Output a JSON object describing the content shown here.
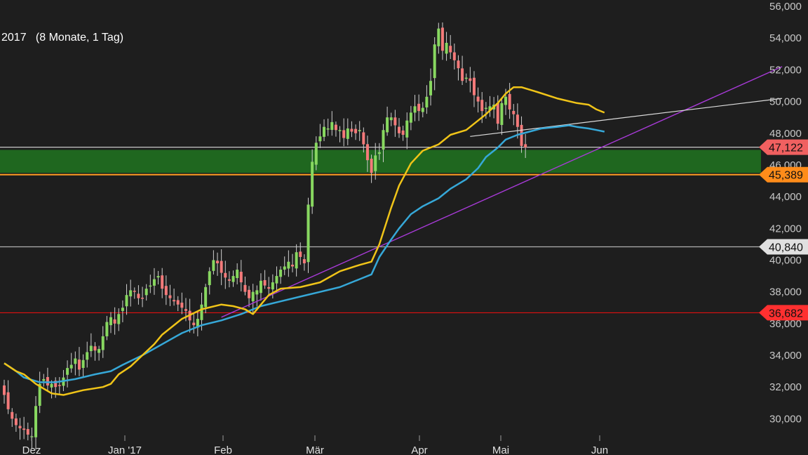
{
  "header": {
    "period_label": "2017   (8 Monate, 1 Tag)"
  },
  "chart_data": {
    "type": "candlestick",
    "title": "2017   (8 Monate, 1 Tag)",
    "ylim": [
      28.6,
      56.4
    ],
    "grid": false,
    "x_tick_labels": [
      "Dez",
      "Jan '17",
      "Feb",
      "Mär",
      "Apr",
      "Mai",
      "Jun"
    ],
    "y_tick_labels": [
      "30,000",
      "32,000",
      "34,000",
      "36,000",
      "38,000",
      "40,000",
      "42,000",
      "44,000",
      "46,000",
      "48,000",
      "50,000",
      "52,000",
      "54,000",
      "56,000"
    ],
    "y_ticks": [
      30,
      32,
      34,
      36,
      38,
      40,
      42,
      44,
      46,
      48,
      50,
      52,
      54,
      56
    ],
    "candle_closes": [
      31.5,
      30.6,
      30.0,
      29.6,
      29.4,
      29.3,
      29.0,
      28.9,
      30.8,
      32.2,
      32.5,
      32.1,
      32.2,
      32.0,
      32.1,
      32.6,
      33.2,
      33.4,
      33.8,
      33.1,
      33.7,
      34.2,
      34.6,
      34.3,
      34.4,
      35.2,
      36.1,
      36.4,
      36.0,
      36.6,
      37.0,
      37.8,
      38.1,
      38.0,
      37.6,
      37.6,
      38.2,
      38.4,
      38.8,
      39.0,
      38.2,
      37.8,
      37.6,
      37.4,
      37.2,
      37.0,
      36.8,
      36.2,
      35.9,
      36.3,
      37.2,
      38.3,
      39.3,
      40.0,
      39.8,
      39.2,
      38.9,
      38.7,
      39.0,
      39.4,
      38.6,
      38.0,
      37.6,
      38.0,
      38.1,
      38.7,
      38.4,
      38.2,
      38.6,
      39.0,
      39.4,
      39.6,
      39.9,
      39.6,
      40.5,
      40.2,
      39.8,
      43.5,
      46.2,
      47.4,
      47.8,
      48.4,
      48.3,
      48.7,
      48.2,
      48.2,
      47.7,
      48.3,
      48.1,
      48.0,
      48.2,
      47.3,
      46.3,
      45.5,
      46.6,
      46.8,
      48.2,
      49.0,
      49.0,
      48.5,
      48.0,
      47.9,
      48.8,
      49.3,
      49.7,
      49.4,
      49.6,
      50.3,
      51.3,
      53.6,
      54.6,
      53.2,
      53.7,
      53.1,
      52.6,
      52.1,
      51.3,
      51.5,
      51.3,
      50.4,
      50.0,
      49.4,
      49.6,
      49.7,
      49.8,
      48.6,
      49.9,
      50.3,
      49.5,
      49.2,
      48.4,
      47.2,
      47.1
    ],
    "moving_average_yellow": [
      [
        0,
        33.5
      ],
      [
        3,
        33.0
      ],
      [
        5,
        32.8
      ],
      [
        7,
        32.4
      ],
      [
        8,
        32.2
      ],
      [
        10,
        31.9
      ],
      [
        12,
        31.6
      ],
      [
        15,
        31.5
      ],
      [
        20,
        31.8
      ],
      [
        25,
        32.0
      ],
      [
        27,
        32.2
      ],
      [
        29,
        32.8
      ],
      [
        32,
        33.3
      ],
      [
        35,
        34.0
      ],
      [
        38,
        34.7
      ],
      [
        40,
        35.3
      ],
      [
        45,
        36.3
      ],
      [
        50,
        36.9
      ],
      [
        55,
        37.2
      ],
      [
        58,
        37.1
      ],
      [
        61,
        36.9
      ],
      [
        63,
        36.6
      ],
      [
        67,
        37.8
      ],
      [
        70,
        38.2
      ],
      [
        75,
        38.3
      ],
      [
        80,
        38.6
      ],
      [
        85,
        39.3
      ],
      [
        90,
        39.7
      ],
      [
        93,
        39.9
      ],
      [
        95,
        41.0
      ],
      [
        98,
        43.3
      ],
      [
        100,
        44.7
      ],
      [
        103,
        46.1
      ],
      [
        106,
        46.9
      ],
      [
        110,
        47.3
      ],
      [
        113,
        47.9
      ],
      [
        117,
        48.2
      ],
      [
        120,
        48.8
      ],
      [
        122,
        49.2
      ],
      [
        125,
        49.9
      ],
      [
        127,
        50.5
      ],
      [
        129,
        50.9
      ],
      [
        131,
        50.9
      ],
      [
        135,
        50.6
      ],
      [
        140,
        50.2
      ],
      [
        145,
        49.9
      ],
      [
        148,
        49.8
      ],
      [
        150,
        49.5
      ],
      [
        152,
        49.3
      ]
    ],
    "moving_average_blue": [
      [
        0,
        33.5
      ],
      [
        3,
        33.0
      ],
      [
        5,
        32.6
      ],
      [
        9,
        32.3
      ],
      [
        13,
        32.3
      ],
      [
        18,
        32.5
      ],
      [
        23,
        32.8
      ],
      [
        27,
        33.0
      ],
      [
        30,
        33.4
      ],
      [
        35,
        34.0
      ],
      [
        40,
        34.7
      ],
      [
        45,
        35.4
      ],
      [
        50,
        35.9
      ],
      [
        55,
        36.2
      ],
      [
        60,
        36.6
      ],
      [
        65,
        37.1
      ],
      [
        70,
        37.4
      ],
      [
        75,
        37.7
      ],
      [
        80,
        38.0
      ],
      [
        85,
        38.3
      ],
      [
        90,
        38.8
      ],
      [
        93,
        39.1
      ],
      [
        95,
        40.2
      ],
      [
        98,
        41.3
      ],
      [
        100,
        42.0
      ],
      [
        103,
        42.9
      ],
      [
        106,
        43.4
      ],
      [
        110,
        43.9
      ],
      [
        113,
        44.5
      ],
      [
        117,
        45.1
      ],
      [
        120,
        45.8
      ],
      [
        122,
        46.5
      ],
      [
        125,
        47.1
      ],
      [
        127,
        47.6
      ],
      [
        130,
        47.9
      ],
      [
        133,
        48.1
      ],
      [
        136,
        48.3
      ],
      [
        140,
        48.4
      ],
      [
        143,
        48.5
      ],
      [
        145,
        48.4
      ],
      [
        148,
        48.3
      ],
      [
        150,
        48.2
      ],
      [
        152,
        48.1
      ]
    ],
    "trendline_purple": [
      [
        55,
        36.4
      ],
      [
        197,
        52.2
      ]
    ],
    "trendline_white": [
      [
        118,
        47.8
      ],
      [
        197,
        50.2
      ]
    ],
    "band": {
      "from": 45.5,
      "to": 46.95,
      "color": "#1f6f1f"
    },
    "horizontal_lines": [
      {
        "value": 47.122,
        "label": "47,122",
        "color": "#c8c8c8",
        "badge": "#f06060"
      },
      {
        "value": 45.389,
        "label": "45,389",
        "color": "#ff9b22",
        "badge": "#ff8c1a"
      },
      {
        "value": 40.84,
        "label": "40,840",
        "color": "#b0b0b0",
        "badge": "#e0e0e0"
      },
      {
        "value": 36.682,
        "label": "36,682",
        "color": "#e01010",
        "badge": "#ff3030"
      }
    ],
    "colors": {
      "background": "#1e1e1e",
      "up": "#88d860",
      "down": "#f47a7a",
      "yellow": "#f0c418",
      "blue": "#36a8d8",
      "purple": "#a83ad8"
    }
  }
}
